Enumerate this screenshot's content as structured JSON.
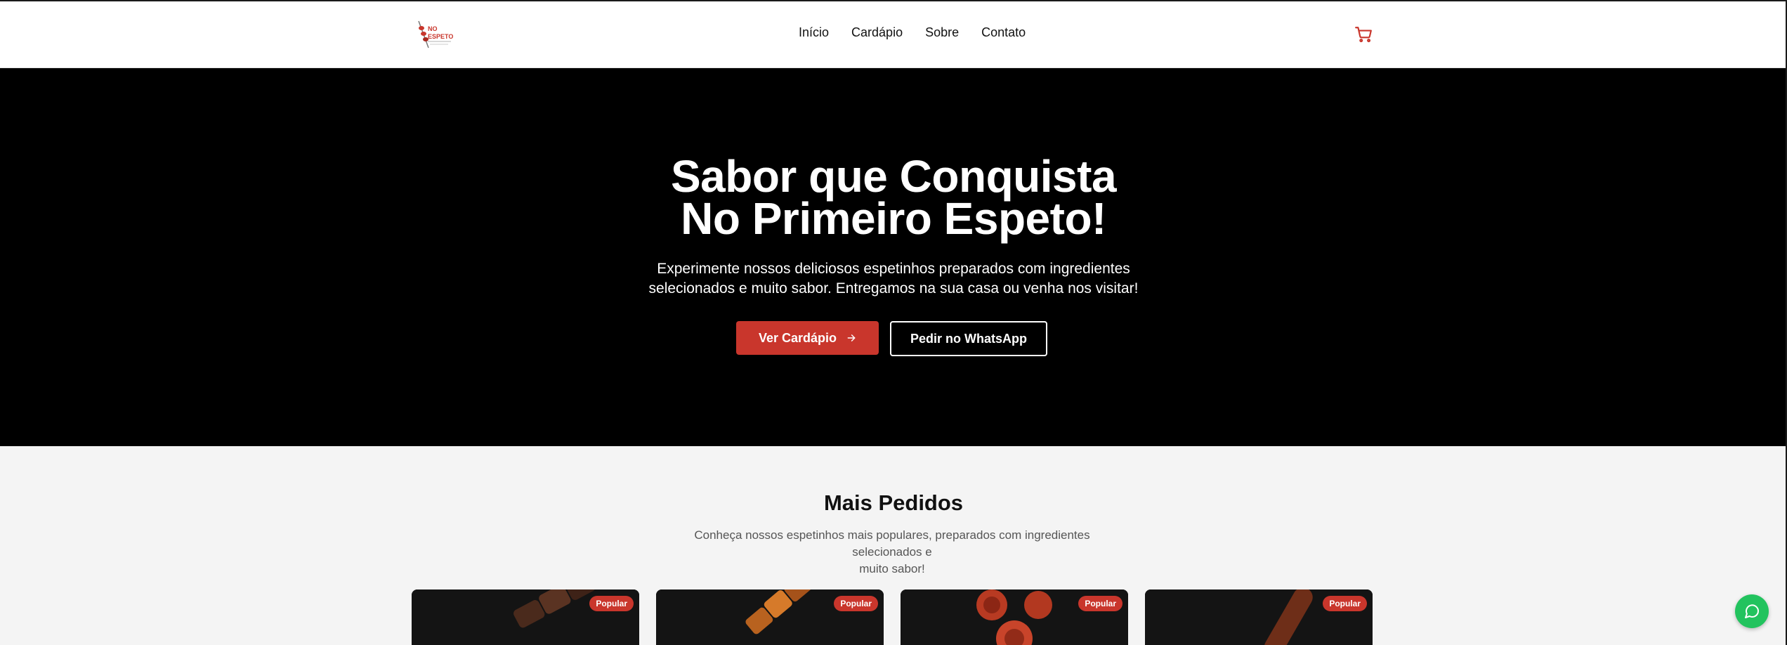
{
  "header": {
    "logo_text": "NO ESPETO",
    "nav": [
      "Início",
      "Cardápio",
      "Sobre",
      "Contato"
    ],
    "cart_icon": "cart-icon"
  },
  "hero": {
    "title_line1": "Sabor que Conquista",
    "title_line2": "No Primeiro Espeto!",
    "subtitle_line1": "Experimente nossos deliciosos espetinhos preparados com ingredientes",
    "subtitle_line2": "selecionados e muito sabor. Entregamos na sua casa ou venha nos visitar!",
    "primary_button": "Ver Cardápio",
    "secondary_button": "Pedir no WhatsApp"
  },
  "popular": {
    "title": "Mais Pedidos",
    "subtitle_line1": "Conheça nossos espetinhos mais populares, preparados com ingredientes selecionados e",
    "subtitle_line2": "muito sabor!",
    "cards": [
      {
        "badge": "Popular"
      },
      {
        "badge": "Popular"
      },
      {
        "badge": "Popular"
      },
      {
        "badge": "Popular"
      }
    ]
  },
  "colors": {
    "accent": "#c9362c",
    "hero_bg": "#000000",
    "whatsapp": "#22c35e"
  }
}
